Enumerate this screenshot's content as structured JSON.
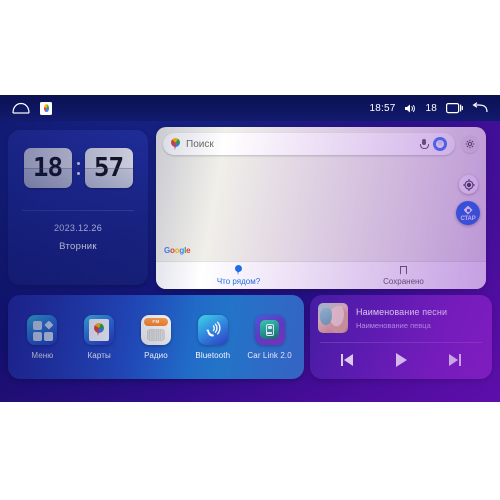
{
  "statusbar": {
    "home_icon": "home-icon",
    "maps_badge_icon": "google-maps-badge-icon",
    "time": "18:57",
    "volume_icon": "volume-icon",
    "volume_level": "18",
    "recents_icon": "recents-icon",
    "back_icon": "back-icon"
  },
  "clock_widget": {
    "hours": "18",
    "minutes": "57",
    "date": "2023.12.26",
    "weekday": "Вторник"
  },
  "maps_card": {
    "search": {
      "placeholder": "Поиск",
      "pin_icon": "google-maps-pin-icon",
      "mic_icon": "microphone-icon",
      "avatar_icon": "account-avatar-icon",
      "settings_icon": "gear-icon"
    },
    "watermark": "Google",
    "locate_icon": "locate-me-icon",
    "start_button": {
      "label": "СТАР",
      "icon": "navigation-diamond-icon"
    },
    "tabs": [
      {
        "label": "Что рядом?",
        "icon": "map-pin-icon",
        "active": true
      },
      {
        "label": "Сохранено",
        "icon": "bookmark-icon",
        "active": false
      }
    ]
  },
  "dock": {
    "apps": [
      {
        "label": "Меню",
        "icon": "apps-grid-icon"
      },
      {
        "label": "Карты",
        "icon": "google-maps-icon"
      },
      {
        "label": "Радио",
        "icon": "fm-radio-icon",
        "band": "FM"
      },
      {
        "label": "Bluetooth",
        "icon": "bluetooth-phone-icon"
      },
      {
        "label": "Car Link 2.0",
        "icon": "car-link-icon"
      }
    ]
  },
  "music_widget": {
    "album_art": "album-art-portrait",
    "title": "Наименование песни",
    "artist": "Наименование певца",
    "controls": [
      {
        "name": "previous-track",
        "icon": "skip-previous-icon"
      },
      {
        "name": "play",
        "icon": "play-icon"
      },
      {
        "name": "next-track",
        "icon": "skip-next-icon"
      }
    ]
  },
  "colors": {
    "accent_blue": "#1a73e8",
    "screen_blue": "#1b2a96",
    "screen_purple": "#5b0fa8",
    "map_canvas": "#f0efe9"
  }
}
